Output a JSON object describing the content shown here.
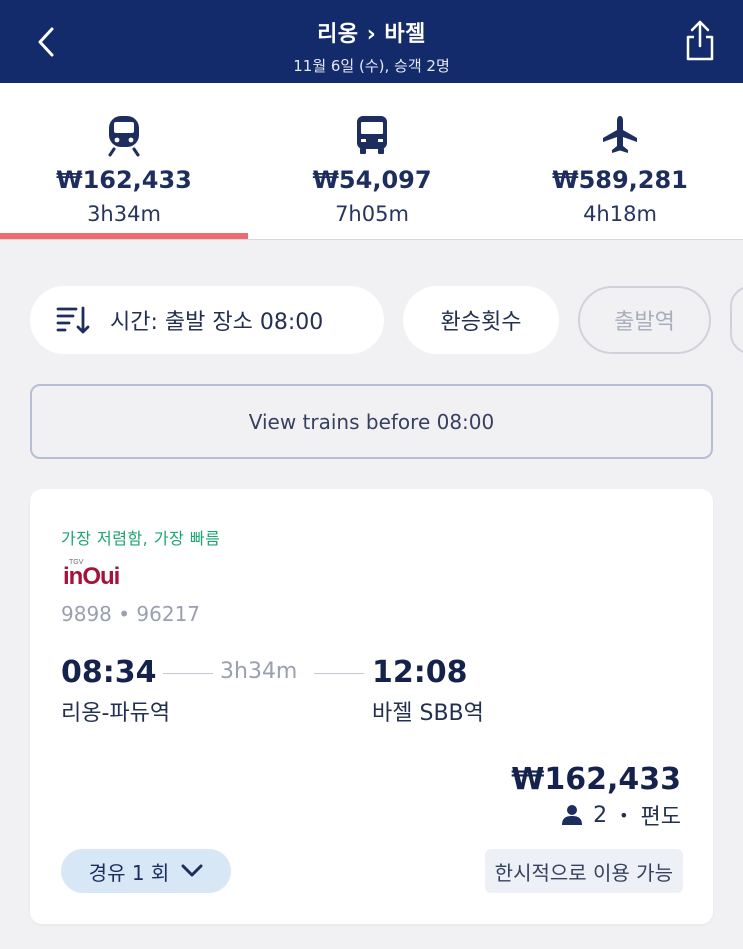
{
  "header": {
    "title": "리옹 › 바젤",
    "subtitle": "11월 6일 (수), 승객 2명"
  },
  "modes": [
    {
      "icon": "train-icon",
      "price": "₩162,433",
      "duration": "3h34m",
      "selected": true
    },
    {
      "icon": "bus-icon",
      "price": "₩54,097",
      "duration": "7h05m",
      "selected": false
    },
    {
      "icon": "plane-icon",
      "price": "₩589,281",
      "duration": "4h18m",
      "selected": false
    }
  ],
  "filters": {
    "sort_label": "시간: 출발 장소 08:00",
    "transfers_label": "환승횟수",
    "origin_label": "출발역"
  },
  "view_before_label": "View trains before 08:00",
  "result": {
    "badge": "가장 저렴함, 가장 빠름",
    "operator_logo_small": "TGV",
    "operator_logo": "inOui",
    "train_numbers": "9898 • 96217",
    "departure_time": "08:34",
    "duration": "3h34m",
    "arrival_time": "12:08",
    "departure_station": "리옹-파듀역",
    "arrival_station": "바젤 SBB역",
    "price": "₩162,433",
    "passengers": "2",
    "trip_type": "편도",
    "stops_label": "경유 1 회",
    "availability": "한시적으로 이용 가능"
  },
  "colors": {
    "header_bg": "#132b6b",
    "accent_underline": "#ef6b6f",
    "badge_green": "#1ba571",
    "operator_red": "#a5123a"
  }
}
